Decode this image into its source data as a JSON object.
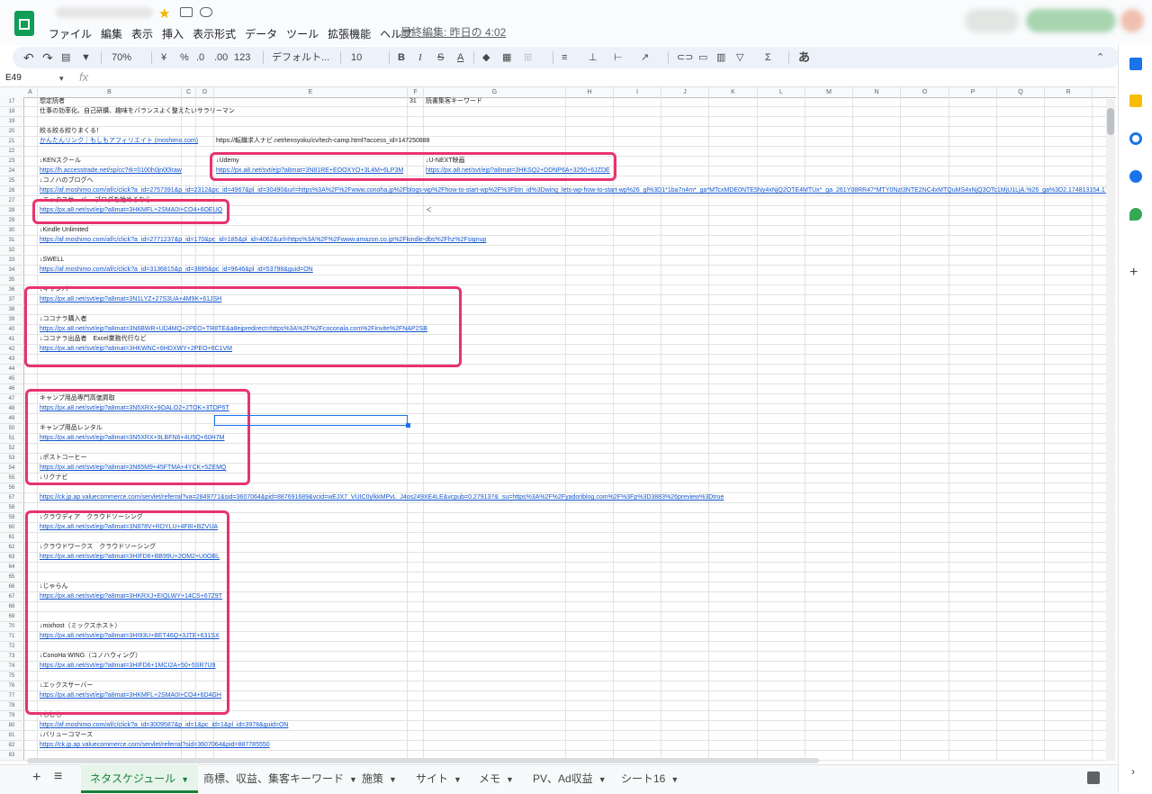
{
  "menu": [
    "ファイル",
    "編集",
    "表示",
    "挿入",
    "表示形式",
    "データ",
    "ツール",
    "拡張機能",
    "ヘルプ"
  ],
  "last_edit": "最終編集: 昨日の 4:02",
  "toolbar": {
    "zoom": "70%",
    "currency": "¥",
    "percent": "%",
    "dec_decrease": ".0",
    "dec_increase": ".00",
    "format_more": "123",
    "font": "デフォルト...",
    "font_size": "10",
    "bold": "B",
    "italic": "I",
    "strike": "S",
    "text_color": "A",
    "input_tools": "あ"
  },
  "name_box": "E49",
  "fx_label": "fx",
  "columns": [
    "A",
    "B",
    "C",
    "D",
    "E",
    "F",
    "G",
    "H",
    "I",
    "J",
    "K",
    "L",
    "M",
    "N",
    "O",
    "P",
    "Q",
    "R"
  ],
  "rows": [
    {
      "n": "17",
      "cells": {
        "B": "想定読者",
        "F": "31",
        "G": "読書集客キーワード"
      }
    },
    {
      "n": "18",
      "cells": {
        "B": "仕事の効率化、自己研鑽、趣味をバランスよく整えたいサラリーマン"
      }
    },
    {
      "n": "19",
      "cells": {}
    },
    {
      "n": "20",
      "cells": {
        "B": "絞る絞る絞りまくる！"
      }
    },
    {
      "n": "21",
      "cells": {
        "B": "かんたんリンク｜もしもアフィリエイト (moshimo.com)",
        "E": "https://転職求人ナビ.net/tensyoku/cv/tech-camp.html?access_id=147250888"
      },
      "links": [
        "B"
      ]
    },
    {
      "n": "22",
      "cells": {}
    },
    {
      "n": "23",
      "cells": {
        "B": "↓KENスクール",
        "E": "↓Udemy",
        "G": "↓U-NEXT映画"
      }
    },
    {
      "n": "24",
      "cells": {
        "B": "https://h.accesstrade.net/sp/cc?rk=0100h0jn00lraw",
        "E": "https://px.a8.net/svt/ejp?a8mat=3N81RE+EOOXYO+3L4M+6LP3M",
        "G": "https://px.a8.net/svt/ejp?a8mat=3HKSQ2+DDNP6A+3250+6JZDE"
      },
      "links": [
        "B",
        "E",
        "G"
      ]
    },
    {
      "n": "25",
      "cells": {
        "B": "↓コノハのブログへ"
      }
    },
    {
      "n": "26",
      "cells": {
        "B": "https://af.moshimo.com/af/c/click?a_id=2757391&p_id=2312&pc_id=4967&pl_id=30490&url=https%3A%2F%2Fwww.conoha.jp%2Fblogs-wp%2Fhow-to-start-wp%2F%3Fbtn_id%3Dwing_lets-wp-how-to-start-wp%26_gl%3D1*1ba7n4m*_ga*MTcxMDE0NTE5Ny4xNjQ2OTE4MTUx*_ga_261Y08RR47*MTY0NzI3NTE2NC4xMTQuMS4xNjQ3OTc1MjU1LjA.%26_ga%3D2.174813154.176"
      },
      "links": [
        "B"
      ]
    },
    {
      "n": "27",
      "cells": {
        "B": "↓エックスサーバー ブログを始めるなら"
      }
    },
    {
      "n": "28",
      "cells": {
        "B": "https://px.a8.net/svt/ejp?a8mat=3HKMFL+2SMA0I+CO4+6OEUQ",
        "G": "＜"
      },
      "links": [
        "B"
      ]
    },
    {
      "n": "29",
      "cells": {}
    },
    {
      "n": "30",
      "cells": {
        "B": "↓Kindle Unlimited"
      }
    },
    {
      "n": "31",
      "cells": {
        "B": "https://af.moshimo.com/af/c/click?a_id=2771237&p_id=170&pc_id=185&pl_id=4062&url=https%3A%2F%2Fwww.amazon.co.jp%2Fkindle-dbs%2Fhz%2Fsignup"
      },
      "links": [
        "B"
      ]
    },
    {
      "n": "32",
      "cells": {}
    },
    {
      "n": "33",
      "cells": {
        "B": "↓SWELL"
      }
    },
    {
      "n": "34",
      "cells": {
        "B": "https://af.moshimo.com/af/c/click?a_id=3136815&p_id=3885&pc_id=9646&pl_id=53798&guid=ON"
      },
      "links": [
        "B"
      ]
    },
    {
      "n": "35",
      "cells": {}
    },
    {
      "n": "36",
      "cells": {
        "B": "↓キャンバ"
      }
    },
    {
      "n": "37",
      "cells": {
        "B": "https://px.a8.net/svt/ejp?a8mat=3N1LYZ+27S3UA+4M9K+61JSH"
      },
      "links": [
        "B"
      ]
    },
    {
      "n": "38",
      "cells": {}
    },
    {
      "n": "39",
      "cells": {
        "B": "↓ココナラ購入者"
      }
    },
    {
      "n": "40",
      "cells": {
        "B": "https://px.a8.net/svt/ejp?a8mat=3N6BWR+UD4MQ+2PEO+TR8TE&a8ejpredirect=https%3A%2F%2Fcoconala.com%2Finvite%2FNAP2SB"
      },
      "links": [
        "B"
      ]
    },
    {
      "n": "41",
      "cells": {
        "B": "↓ココナラ出品者　Excel業務代行など"
      }
    },
    {
      "n": "42",
      "cells": {
        "B": "https://px.a8.net/svt/ejp?a8mat=3HKWNC+6HDXWY+2PEO+6C1VM"
      },
      "links": [
        "B"
      ]
    },
    {
      "n": "43",
      "cells": {}
    },
    {
      "n": "44",
      "cells": {}
    },
    {
      "n": "45",
      "cells": {}
    },
    {
      "n": "46",
      "cells": {}
    },
    {
      "n": "47",
      "cells": {
        "B": "キャンプ用品専門高価買取"
      }
    },
    {
      "n": "48",
      "cells": {
        "B": "https://px.a8.net/svt/ejp?a8mat=3N5XRX+9OALO2+2TOK+3TOP6T"
      },
      "links": [
        "B"
      ]
    },
    {
      "n": "49",
      "cells": {}
    },
    {
      "n": "50",
      "cells": {
        "B": "キャンプ用品レンタル"
      }
    },
    {
      "n": "51",
      "cells": {
        "B": "https://px.a8.net/svt/ejp?a8mat=3N5XRX+9LBFN6+4U5Q+60H7M"
      },
      "links": [
        "B"
      ]
    },
    {
      "n": "52",
      "cells": {}
    },
    {
      "n": "53",
      "cells": {
        "B": "↓ポストコーヒー"
      }
    },
    {
      "n": "54",
      "cells": {
        "B": "https://px.a8.net/svt/ejp?a8mat=3N65M9+45FTMA+4YCK+5ZEMQ"
      },
      "links": [
        "B"
      ]
    },
    {
      "n": "55",
      "cells": {
        "B": "↓リクナビ"
      }
    },
    {
      "n": "56",
      "cells": {}
    },
    {
      "n": "57",
      "cells": {
        "B": "https://ck.jp.ap.valuecommerce.com/servlet/referral?va=2849771&sid=3607064&pid=887691689&vcid=wEJX7_VUIC0ylkkMPvL_J4os249XE4LE&vcpub=0.279137&_su=https%3A%2F%2Fyadoriblog.com%2F%3Fp%3D3883%26preview%3Dtrue"
      },
      "links": [
        "B"
      ]
    },
    {
      "n": "58",
      "cells": {}
    },
    {
      "n": "59",
      "cells": {
        "B": "↓クラウディア　クラウドソーシング"
      }
    },
    {
      "n": "60",
      "cells": {
        "B": "https://px.a8.net/svt/ejp?a8mat=3N878V+RDYLU+4F8I+BZVUA"
      },
      "links": [
        "B"
      ]
    },
    {
      "n": "61",
      "cells": {}
    },
    {
      "n": "62",
      "cells": {
        "B": "↓クラウドワークス　クラウドソーシング"
      }
    },
    {
      "n": "63",
      "cells": {
        "B": "https://px.a8.net/svt/ejp?a8mat=3HIFD6+BB99U+2OM2+U0OBL"
      },
      "links": [
        "B"
      ]
    },
    {
      "n": "64",
      "cells": {}
    },
    {
      "n": "65",
      "cells": {}
    },
    {
      "n": "66",
      "cells": {
        "B": "↓じゃらん"
      }
    },
    {
      "n": "67",
      "cells": {
        "B": "https://px.a8.net/svt/ejp?a8mat=3HKRXJ+EIQLWY+14CS+67Z9T"
      },
      "links": [
        "B"
      ]
    },
    {
      "n": "68",
      "cells": {}
    },
    {
      "n": "69",
      "cells": {}
    },
    {
      "n": "70",
      "cells": {
        "B": "↓mixhost（ミックスホスト）"
      }
    },
    {
      "n": "71",
      "cells": {
        "B": "https://px.a8.net/svt/ejp?a8mat=3HI93U+BET46Q+3JTE+631SX"
      },
      "links": [
        "B"
      ]
    },
    {
      "n": "72",
      "cells": {}
    },
    {
      "n": "73",
      "cells": {
        "B": "↓ConoHa WING（コノハウィング）"
      }
    },
    {
      "n": "74",
      "cells": {
        "B": "https://px.a8.net/svt/ejp?a8mat=3HIFD6+1MCI2A+50+5SR7U9"
      },
      "links": [
        "B"
      ]
    },
    {
      "n": "75",
      "cells": {}
    },
    {
      "n": "76",
      "cells": {
        "B": "↓エックスサーバー"
      }
    },
    {
      "n": "77",
      "cells": {
        "B": "https://px.a8.net/svt/ejp?a8mat=3HKMFL+2SMA0I+CO4+6D4GH"
      },
      "links": [
        "B"
      ]
    },
    {
      "n": "78",
      "cells": {}
    },
    {
      "n": "79",
      "cells": {
        "B": "↓もしも"
      }
    },
    {
      "n": "80",
      "cells": {
        "B": "https://af.moshimo.com/af/c/click?a_id=3009587&p_id=1&pc_id=1&pl_id=3978&guid=ON"
      },
      "links": [
        "B"
      ]
    },
    {
      "n": "81",
      "cells": {
        "B": "↓バリューコマース"
      }
    },
    {
      "n": "82",
      "cells": {
        "B": "https://ck.jp.ap.valuecommerce.com/servlet/referral?sid=3607064&pid=887785550"
      },
      "links": [
        "B"
      ]
    },
    {
      "n": "83",
      "cells": {}
    }
  ],
  "tabs": [
    "ネタスケジュール",
    "商標、収益、集客キーワード",
    "施策",
    "サイト",
    "メモ",
    "PV、Ad収益",
    "シート16"
  ],
  "active_tab": 0,
  "add_sheet": "+",
  "all_sheets": "≡",
  "colors": {
    "accent": "#188038",
    "link": "#1155cc",
    "highlight": "#e8336d",
    "select": "#1a73e8"
  },
  "icons": [
    "sheets-logo-icon",
    "star-icon",
    "move-folder-icon",
    "cloud-status-icon",
    "undo-icon",
    "redo-icon",
    "print-icon",
    "paint-format-icon",
    "fill-color-icon",
    "borders-icon",
    "merge-icon",
    "align-icon",
    "link-icon",
    "comment-icon",
    "chart-icon",
    "filter-icon",
    "functions-icon",
    "collapse-icon",
    "calendar-icon",
    "keep-icon",
    "tasks-icon",
    "contacts-icon",
    "maps-icon",
    "add-icon",
    "explore-icon"
  ]
}
